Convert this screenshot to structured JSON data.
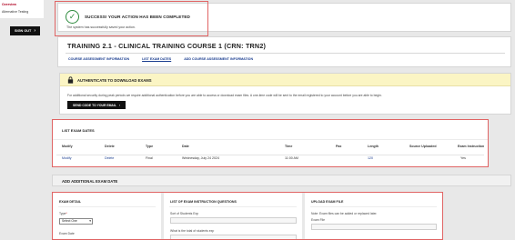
{
  "sidebar": {
    "link_primary": "Overview",
    "link_secondary": "Alternative Testing",
    "sign_out": "SIGN OUT"
  },
  "success": {
    "title": "SUCCESS! YOUR ACTION HAS BEEN COMPLETED",
    "message": "The system has successfully saved your action."
  },
  "training": {
    "title": "TRAINING 2.1 - CLINICAL TRAINING COURSE 1 (CRN: TRN2)",
    "tabs": [
      {
        "label": "COURSE ASSESSMENT INFORMATION"
      },
      {
        "label": "LIST EXAM DATES"
      },
      {
        "label": "ADD COURSE ASSESSMENT INFORMATION"
      }
    ]
  },
  "auth": {
    "title": "AUTHENTICATE TO DOWNLOAD EXAMS",
    "text": "For additional security during peak periods we require additional authentication before you are able to access or download exam files. A one-time code will be sent to the email registered to your account before you are able to begin.",
    "send_button": "SEND CODE TO YOUR EMAIL"
  },
  "exam_dates": {
    "title": "LIST EXAM DATES",
    "columns": [
      "Modify",
      "Delete",
      "Type",
      "Date",
      "Time",
      "Pax",
      "Length",
      "Source Uploaded",
      "Exam Instruction"
    ],
    "rows": [
      [
        "Modify",
        "Delete",
        "Final",
        "Wednesday, July 24 2024",
        "11:00 AM",
        "",
        "120",
        "",
        "Yes"
      ]
    ]
  },
  "add_exam": {
    "title": "ADD ADDITIONAL EXAM DATE",
    "exam_detail": {
      "title": "EXAM DETAIL",
      "type_label": "Type",
      "select_value": "Select One",
      "date_label": "Exam Date"
    },
    "list_col": {
      "title": "LIST OF EXAM INSTRUCTION QUESTIONS",
      "field1": "Sort of Students Exp",
      "field2": "What is the total of students exp"
    },
    "upload_col": {
      "title": "UPLOAD EXAM FILE",
      "note": "Note: Exam files can be added or replaced later.",
      "file_label": "Exam File"
    }
  }
}
